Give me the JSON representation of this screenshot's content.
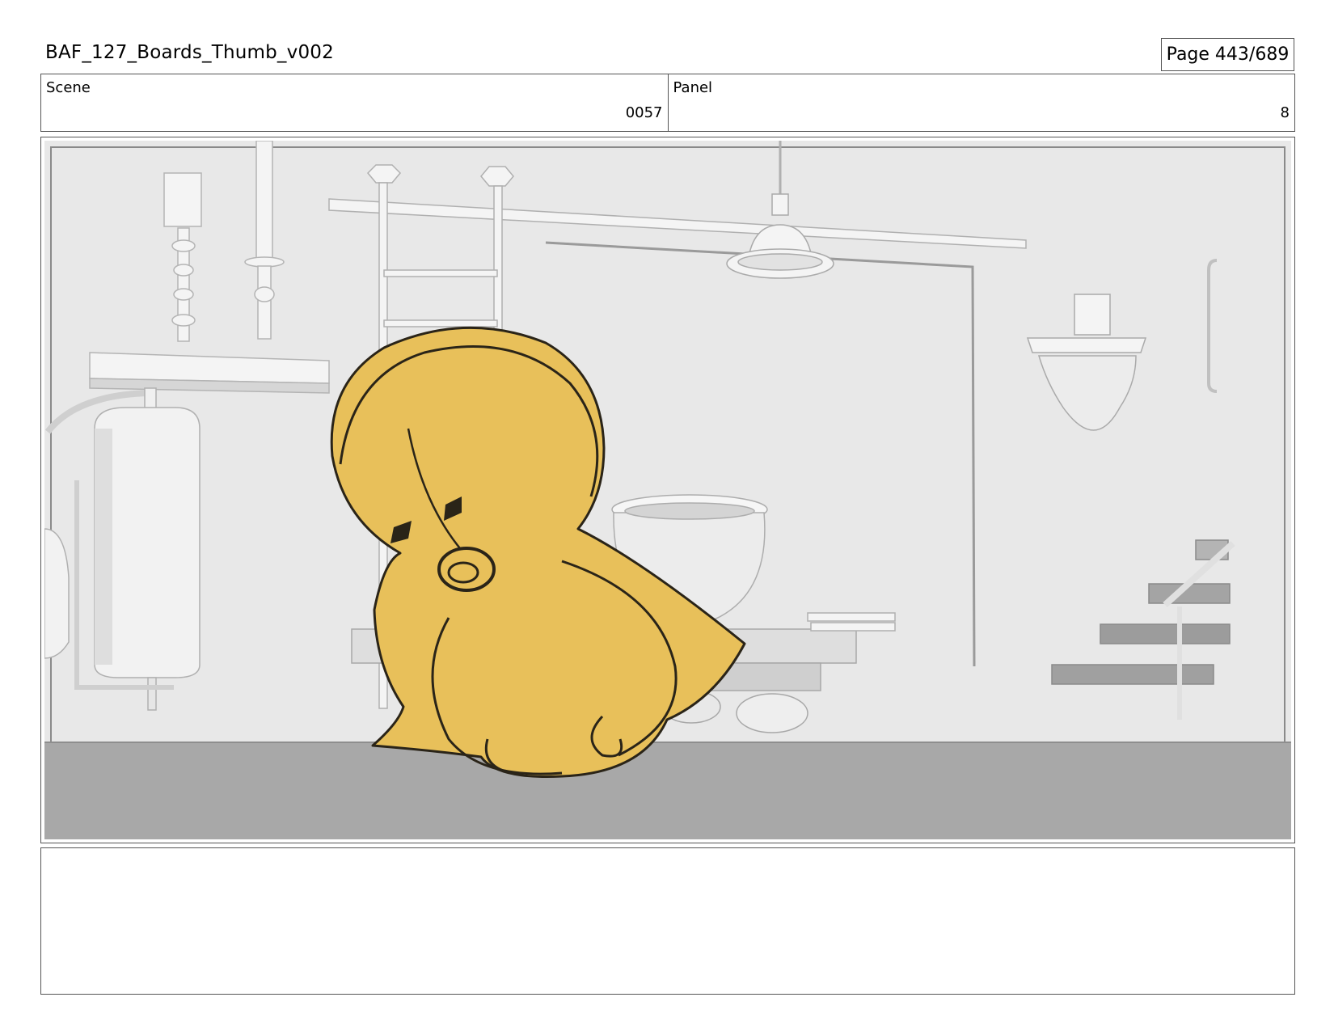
{
  "header": {
    "doc_title": "BAF_127_Boards_Thumb_v002",
    "page_label": "Page 443/689"
  },
  "info": {
    "scene_label": "Scene",
    "scene_value": "0057",
    "panel_label": "Panel",
    "panel_value": "8"
  },
  "panel": {
    "colors": {
      "wall": "#e8e8e8",
      "floor": "#a8a8a8",
      "character": "#e8c05a",
      "line": "#2a2418",
      "props": "#f4f4f4",
      "prop_shadow": "#c9c9c9"
    }
  },
  "notes": {
    "text": ""
  }
}
